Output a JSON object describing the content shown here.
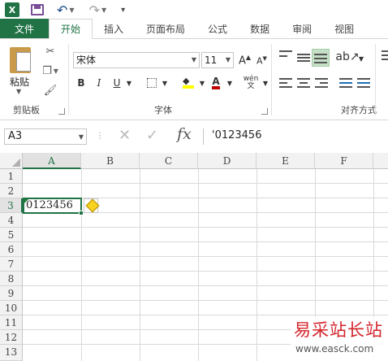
{
  "app": {
    "title": "Excel",
    "logo": "X"
  },
  "quick_access": {
    "save_icon": "save-icon",
    "undo_icon": "undo-icon",
    "redo_icon": "redo-icon",
    "customize_icon": "customize-icon"
  },
  "tabs": [
    {
      "label": "文件"
    },
    {
      "label": "开始"
    },
    {
      "label": "插入"
    },
    {
      "label": "页面布局"
    },
    {
      "label": "公式"
    },
    {
      "label": "数据"
    },
    {
      "label": "审阅"
    },
    {
      "label": "视图"
    }
  ],
  "ribbon": {
    "clipboard": {
      "paste_label": "粘贴",
      "group_label": "剪贴板"
    },
    "font": {
      "name": "宋体",
      "size": "11",
      "bold": "B",
      "italic": "I",
      "underline": "U",
      "group_label": "字体",
      "phonetic": "wén"
    },
    "alignment": {
      "group_label": "对齐方式"
    }
  },
  "formula_bar": {
    "name_box": "A3",
    "fx": "fx",
    "value": "'0123456"
  },
  "grid": {
    "columns": [
      "A",
      "B",
      "C",
      "D",
      "E",
      "F"
    ],
    "rows": [
      "1",
      "2",
      "3",
      "4",
      "5",
      "6",
      "7",
      "8",
      "9",
      "10",
      "11",
      "12",
      "13"
    ],
    "selected_cell": "A3",
    "cell_a3": "0123456"
  },
  "watermark": {
    "main": "易采站长站",
    "sub": "www.easck.com"
  },
  "colors": {
    "accent": "#217346",
    "font_color": "#c00000",
    "highlight": "#ffff00"
  }
}
